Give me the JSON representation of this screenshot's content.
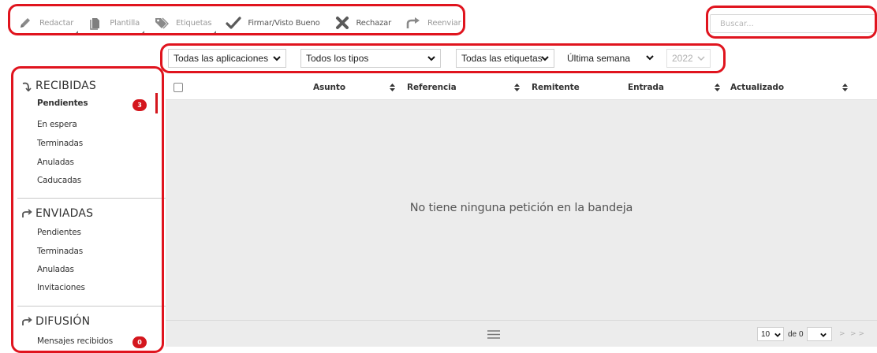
{
  "toolbar": {
    "items": [
      {
        "label": "Redactar",
        "icon": "pencil-icon",
        "enabled": false
      },
      {
        "label": "Plantilla",
        "icon": "document-icon",
        "enabled": false
      },
      {
        "label": "Etiquetas",
        "icon": "tag-icon",
        "enabled": false
      },
      {
        "label": "Firmar/Visto Bueno",
        "icon": "checkmark-icon",
        "enabled": true
      },
      {
        "label": "Rechazar",
        "icon": "x-icon",
        "enabled": true
      },
      {
        "label": "Reenviar",
        "icon": "forward-arrow-icon",
        "enabled": false
      }
    ]
  },
  "search": {
    "placeholder": "Buscar..."
  },
  "filters": {
    "applications": "Todas las aplicaciones",
    "types": "Todos los tipos",
    "tags": "Todas las etiquetas",
    "period": "Última semana",
    "year": "2022"
  },
  "sidebar": {
    "received": {
      "title": "RECIBIDAS",
      "items": [
        {
          "label": "Pendientes",
          "badge": "3"
        },
        {
          "label": "En espera"
        },
        {
          "label": "Terminadas"
        },
        {
          "label": "Anuladas"
        },
        {
          "label": "Caducadas"
        }
      ]
    },
    "sent": {
      "title": "ENVIADAS",
      "items": [
        {
          "label": "Pendientes"
        },
        {
          "label": "Terminadas"
        },
        {
          "label": "Anuladas"
        },
        {
          "label": "Invitaciones"
        }
      ]
    },
    "broadcast": {
      "title": "DIFUSIÓN",
      "items": [
        {
          "label": "Mensajes recibidos",
          "badge": "0"
        }
      ]
    }
  },
  "table": {
    "columns": [
      "Asunto",
      "Referencia",
      "Remitente",
      "Entrada",
      "Actualizado"
    ],
    "empty_message": "No tiene ninguna petición en la bandeja"
  },
  "pagination": {
    "page_size": "10",
    "of_label": "de",
    "total_pages": "0",
    "page": "",
    "next": ">",
    "last": ">>"
  },
  "colors": {
    "accent_red": "#d4161d",
    "highlight_red": "#e0141e",
    "table_bg": "#ececec"
  }
}
